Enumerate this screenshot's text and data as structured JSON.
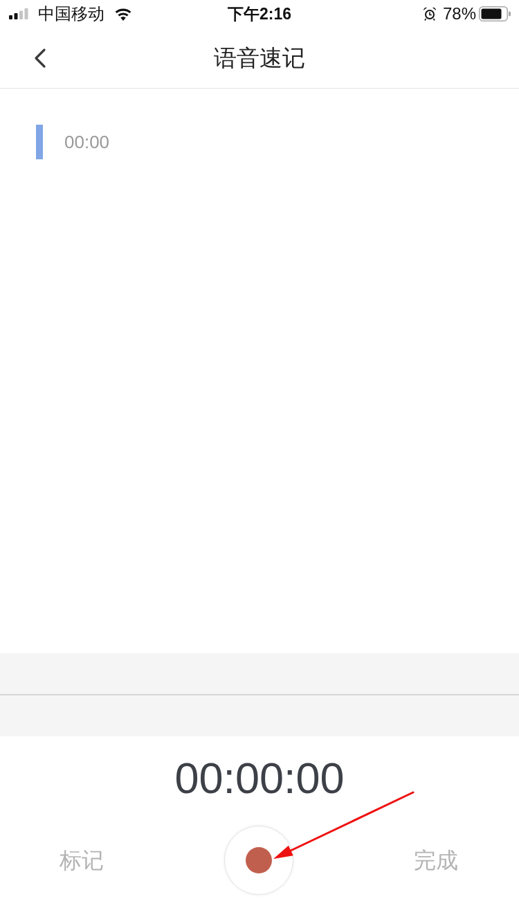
{
  "status_bar": {
    "carrier": "中国移动",
    "time": "下午2:16",
    "battery_percent": "78%"
  },
  "nav_bar": {
    "title": "语音速记"
  },
  "segments": [
    {
      "time": "00:00"
    }
  ],
  "timer": "00:00:00",
  "mark_button": {
    "label": "标记",
    "disabled": true
  },
  "done_button": {
    "label": "完成",
    "disabled": true
  },
  "annotation": {
    "kind": "arrow"
  }
}
